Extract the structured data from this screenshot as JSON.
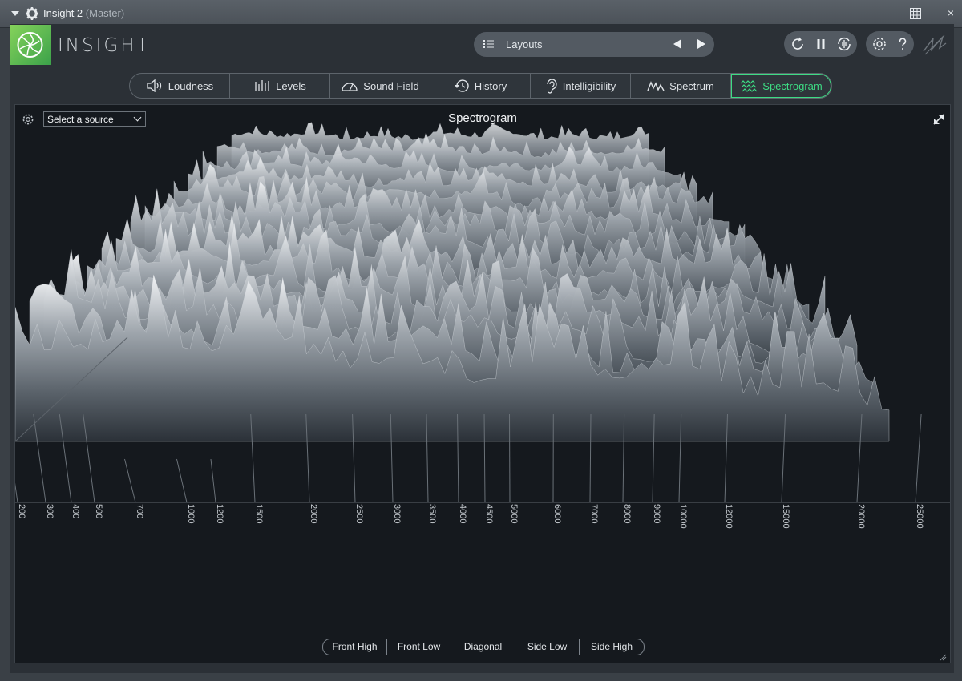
{
  "window": {
    "title": "Insight 2",
    "title_suffix": "(Master)",
    "grid_icon": "grid-icon",
    "minimize_glyph": "–",
    "close_glyph": "×"
  },
  "header": {
    "brand": "INSIGHT",
    "layouts_label": "Layouts",
    "accent_color": "#3ddc84"
  },
  "tabs": [
    {
      "label": "Loudness",
      "icon": "speaker-icon"
    },
    {
      "label": "Levels",
      "icon": "levels-icon"
    },
    {
      "label": "Sound Field",
      "icon": "sound-field-icon"
    },
    {
      "label": "History",
      "icon": "history-icon"
    },
    {
      "label": "Intelligibility",
      "icon": "ear-icon"
    },
    {
      "label": "Spectrum",
      "icon": "spectrum-icon"
    },
    {
      "label": "Spectrogram",
      "icon": "spectrogram-icon",
      "active": true
    }
  ],
  "view": {
    "title": "Spectrogram",
    "source_select": "Select a source",
    "freq_ticks": [
      "200",
      "300",
      "400",
      "500",
      "700",
      "1000",
      "1200",
      "1500",
      "2000",
      "2500",
      "3000",
      "3500",
      "4000",
      "4500",
      "5000",
      "6000",
      "7000",
      "8000",
      "9000",
      "10000",
      "12000",
      "15000",
      "20000",
      "25000"
    ],
    "view_modes": [
      "Front High",
      "Front Low",
      "Diagonal",
      "Side Low",
      "Side High"
    ]
  }
}
